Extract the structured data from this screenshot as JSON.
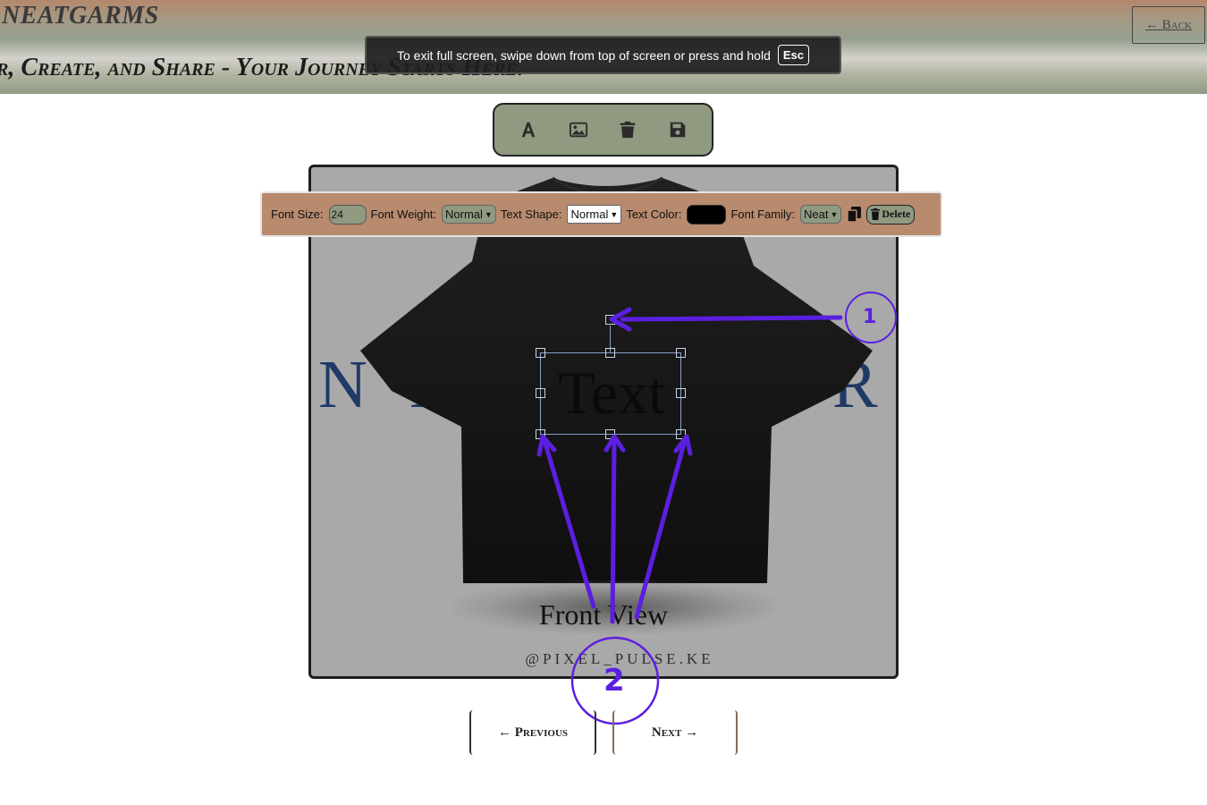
{
  "header": {
    "brand": "NEATGARMS",
    "tagline": "r, Create, and Share - Your Journey Starts Here.",
    "back_label": "← Back"
  },
  "toast": {
    "message": "To exit full screen, swipe down from top of screen or press and hold",
    "key": "Esc"
  },
  "toolbar": {
    "tools": [
      {
        "icon": "text-icon"
      },
      {
        "icon": "image-icon"
      },
      {
        "icon": "trash-icon"
      },
      {
        "icon": "save-icon"
      }
    ]
  },
  "canvas": {
    "background_text": "N E A T G A R M S",
    "text_object": "Text",
    "view_label": "Front View",
    "watermark": "@PIXEL_PULSE.KE"
  },
  "text_properties": {
    "font_size_label": "Font Size:",
    "font_size_value": "24",
    "font_weight_label": "Font Weight:",
    "font_weight_value": "Normal",
    "text_shape_label": "Text Shape:",
    "text_shape_value": "Normal",
    "text_color_label": "Text Color:",
    "text_color_value": "#000000",
    "font_family_label": "Font Family:",
    "font_family_value": "Neat",
    "copy_icon": "copy-icon",
    "delete_label": "Delete"
  },
  "annotations": {
    "callout_1": "1",
    "callout_2": "2",
    "color": "#5b1fe0"
  },
  "pagination": {
    "prev_label": "← Previous",
    "next_label": "Next →"
  }
}
